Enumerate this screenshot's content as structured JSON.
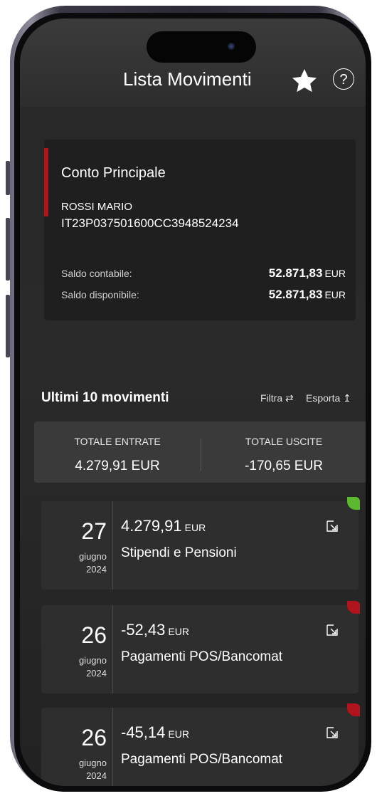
{
  "header": {
    "title": "Lista Movimenti"
  },
  "account": {
    "name": "Conto Principale",
    "holder": "ROSSI MARIO",
    "iban": "IT23P037501600CC3948524234",
    "saldo_contabile_label": "Saldo contabile:",
    "saldo_contabile_value": "52.871,83",
    "saldo_disponibile_label": "Saldo disponibile:",
    "saldo_disponibile_value": "52.871,83",
    "currency": "EUR"
  },
  "movements": {
    "title": "Ultimi 10 movimenti",
    "filter_label": "Filtra",
    "export_label": "Esporta",
    "totals": {
      "entrate_label": "TOTALE ENTRATE",
      "entrate_value": "4.279,91 EUR",
      "uscite_label": "TOTALE USCITE",
      "uscite_value": "-170,65 EUR"
    },
    "items": [
      {
        "day": "27",
        "month": "giugno",
        "year": "2024",
        "amount": "4.279,91",
        "currency": "EUR",
        "description": "Stipendi e Pensioni",
        "indicator_color": "#5cb82e"
      },
      {
        "day": "26",
        "month": "giugno",
        "year": "2024",
        "amount": "-52,43",
        "currency": "EUR",
        "description": "Pagamenti POS/Bancomat",
        "indicator_color": "#b0141c"
      },
      {
        "day": "26",
        "month": "giugno",
        "year": "2024",
        "amount": "-45,14",
        "currency": "EUR",
        "description": "Pagamenti POS/Bancomat",
        "indicator_color": "#b0141c"
      }
    ]
  },
  "colors": {
    "accent": "#b0141c",
    "positive": "#5cb82e",
    "background": "#272727",
    "card": "#1f1f1f"
  }
}
